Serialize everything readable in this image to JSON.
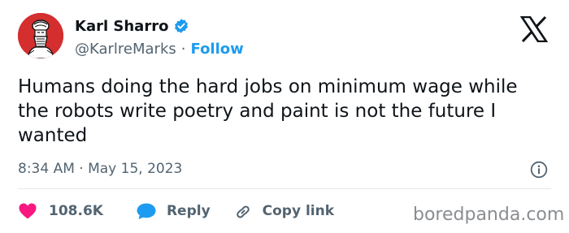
{
  "author": {
    "name": "Karl Sharro",
    "handle": "@KarlreMarks",
    "separator": "·",
    "follow_label": "Follow",
    "avatar_color": "#d42e2e",
    "verified_color": "#1d9bf0"
  },
  "tweet": {
    "text": "Humans doing the hard jobs on minimum wage while the robots write poetry and paint is not the future I wanted",
    "timestamp": "8:34 AM · May 15, 2023"
  },
  "actions": {
    "likes_count": "108.6K",
    "like_color": "#f91880",
    "reply_label": "Reply",
    "reply_color": "#1d9bf0",
    "copy_link_label": "Copy link"
  },
  "icons": [
    "verified-badge-icon",
    "x-logo-icon",
    "info-icon",
    "heart-icon",
    "reply-bubble-icon",
    "link-icon"
  ],
  "watermark": "boredpanda.com"
}
